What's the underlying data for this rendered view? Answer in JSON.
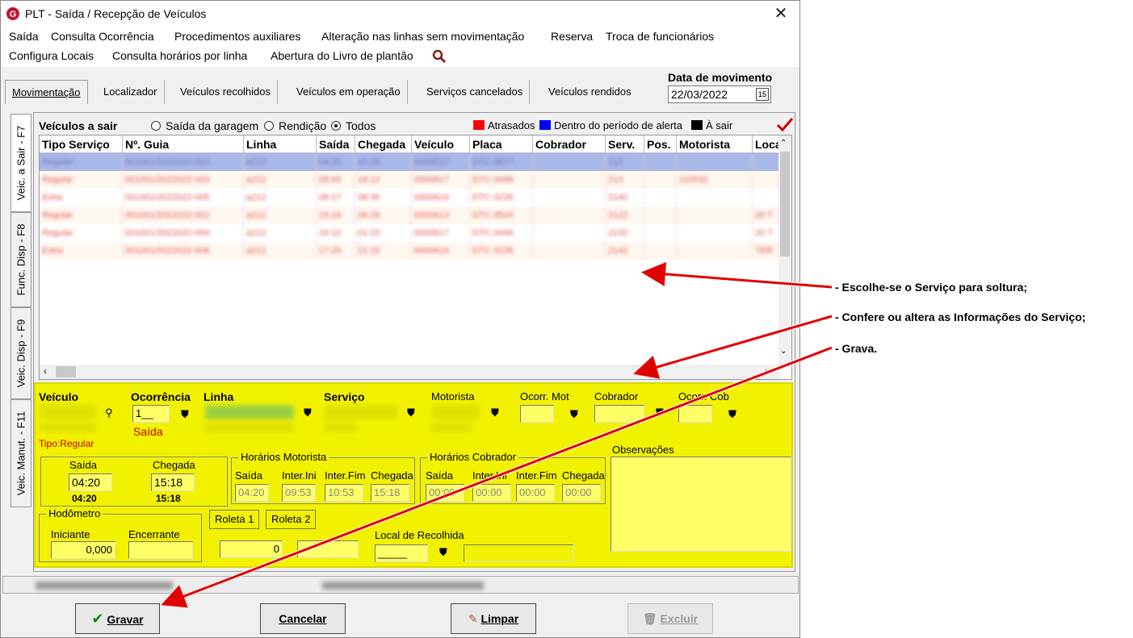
{
  "window": {
    "title": "PLT - Saída / Recepção de Veículos"
  },
  "menu": {
    "row1": [
      "Saída",
      "Consulta Ocorrência",
      "Procedimentos auxiliares",
      "Alteração nas linhas sem movimentação",
      "Reserva",
      "Troca de funcionários"
    ],
    "row2": [
      "Configura Locais",
      "Consulta horários por linha",
      "Abertura do Livro de plantão"
    ]
  },
  "tabs": [
    "Movimentação",
    "Localizador",
    "Veículos recolhidos",
    "Veículos em operação",
    "Serviços cancelados",
    "Veículos rendidos"
  ],
  "date": {
    "label": "Data de movimento",
    "value": "22/03/2022",
    "cal": "15"
  },
  "side_tabs": [
    "Veic. a Sair - F7",
    "Func. Disp - F8",
    "Veic. Disp - F9",
    "Veic. Manut. - F11"
  ],
  "grid": {
    "title": "Veículos a sair",
    "radios": [
      "Saída da garagem",
      "Rendição",
      "Todos"
    ],
    "legend": [
      "Atrasados",
      "Dentro do período de alerta",
      "À sair"
    ],
    "colors": {
      "late": "#ff0000",
      "alert": "#0000ff",
      "pending": "#000000",
      "selected": "#a8b8e8"
    },
    "columns": [
      "Tipo Serviço",
      "Nº. Guia",
      "Linha",
      "Saída",
      "Chegada",
      "Veículo",
      "Placa",
      "Cobrador",
      "Serv.",
      "Pos.",
      "Motorista",
      "Loca"
    ],
    "rows": [
      [
        "Regular",
        "001001/2022022-001",
        "a212",
        "04:20",
        "15:18",
        "0000517",
        "DTC-3677",
        "",
        "213",
        "",
        "",
        ""
      ],
      [
        "Regular",
        "001001/2022022-003",
        "a212",
        "05:00",
        "16:12",
        "0000617",
        "DTC-3446",
        "",
        "213",
        "",
        "110532",
        ""
      ],
      [
        "Extra",
        "001001/2022022-005",
        "a212",
        "06:17",
        "08:35",
        "0000619",
        "DTC-3235",
        "",
        "2140",
        "",
        "",
        ""
      ],
      [
        "Regular",
        "001001/2022022-002",
        "a212",
        "15:18",
        "06:28",
        "0000613",
        "DTC-3524",
        "",
        "2122",
        "",
        "",
        "20 T"
      ],
      [
        "Regular",
        "001001/2022022-004",
        "a212",
        "16:12",
        "01:15",
        "0000617",
        "DTC-3446",
        "",
        "2132",
        "",
        "",
        "20 T"
      ],
      [
        "Extra",
        "001001/2022022-006",
        "a212",
        "17:26",
        "21:15",
        "0000619",
        "DTC-3235",
        "",
        "2142",
        "",
        "",
        "TER"
      ]
    ]
  },
  "form": {
    "veiculo_label": "Veículo",
    "ocorrencia_label": "Ocorrência",
    "ocorrencia_value": "1__",
    "ocorrencia_text": "Saída",
    "linha_label": "Linha",
    "servico_label": "Serviço",
    "motorista_label": "Motorista",
    "ocorr_mot_label": "Ocorr. Mot",
    "cobrador_label": "Cobrador",
    "ocorr_cob_label": "Ocorr. Cob",
    "tipo": "Tipo:Regular",
    "saida_label": "Saída",
    "chegada_label": "Chegada",
    "saida_value": "04:20",
    "chegada_value": "15:18",
    "saida_sub": "04:20",
    "chegada_sub": "15:18",
    "hor_mot_title": "Horários Motorista",
    "hor_cob_title": "Horários Cobrador",
    "hm_labels": [
      "Saída",
      "Inter.Ini",
      "Inter.Fim",
      "Chegada"
    ],
    "hm_values": [
      "04:20",
      "09:53",
      "10:53",
      "15:18"
    ],
    "hc_labels": [
      "Saída",
      "Inter.Ini",
      "Inter.Fim",
      "Chegada"
    ],
    "hc_values": [
      "00:00",
      "00:00",
      "00:00",
      "00:00"
    ],
    "observacoes_label": "Observações",
    "hodometro_title": "Hodômetro",
    "iniciante_label": "Iniciante",
    "encerrante_label": "Encerrante",
    "iniciante_value": "0,000",
    "roleta1": "Roleta 1",
    "roleta2": "Roleta 2",
    "roleta_value": "0",
    "local_label": "Local de Recolhida",
    "local_value": "_____"
  },
  "buttons": {
    "gravar": "Gravar",
    "cancelar": "Cancelar",
    "limpar": "Limpar",
    "excluir": "Excluir"
  },
  "annotations": [
    "- Escolhe-se o Serviço para soltura;",
    "- Confere ou altera as Informações do Serviço;",
    "- Grava."
  ]
}
